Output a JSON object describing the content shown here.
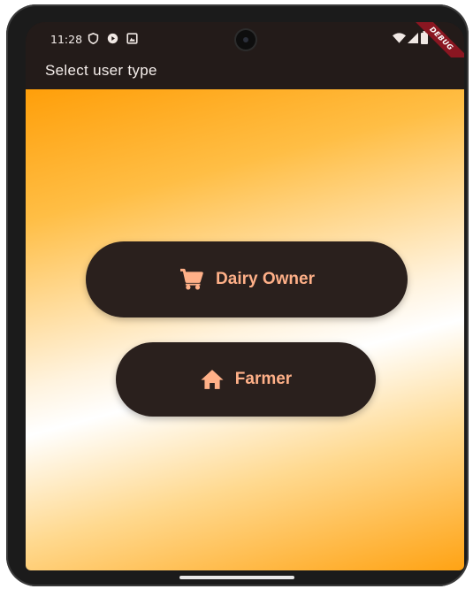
{
  "status_bar": {
    "time": "11:28",
    "left_icons": [
      "shield-icon",
      "play-circle-icon",
      "notification-image-icon"
    ],
    "right_icons": [
      "wifi-icon",
      "signal-icon",
      "battery-icon"
    ],
    "debug_banner": "DEBUG"
  },
  "app_bar": {
    "title": "Select user type"
  },
  "buttons": [
    {
      "label": "Dairy Owner",
      "icon": "shopping-cart-icon"
    },
    {
      "label": "Farmer",
      "icon": "home-icon"
    }
  ],
  "colors": {
    "background_dark": "#231b19",
    "button_bg": "#2a201d",
    "button_text": "#ffb088",
    "gradient_orange": "#ff9f0a",
    "gradient_light": "#fff3de",
    "debug_red": "#8a1621"
  }
}
